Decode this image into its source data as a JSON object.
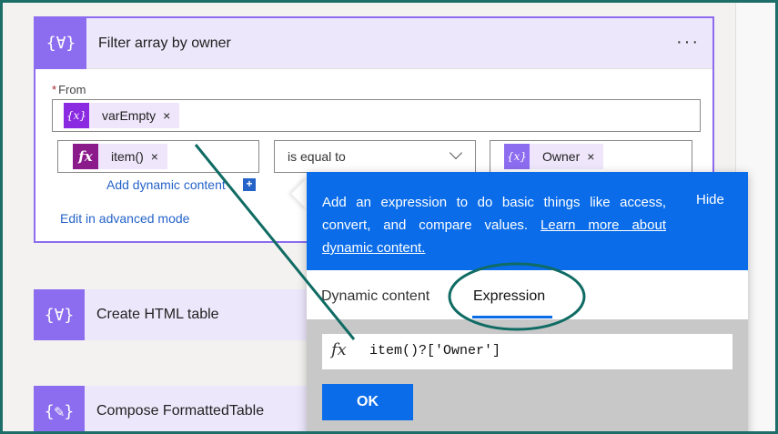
{
  "cards": {
    "filter": {
      "title": "Filter array by owner",
      "icon": "{∀}",
      "more": "···",
      "from_label": "From",
      "required_mark": "*",
      "from_token": {
        "label": "varEmpty",
        "icon": "{x}",
        "remove": "×"
      },
      "left_token": {
        "label": "item()",
        "icon": "fx",
        "remove": "×"
      },
      "operator": "is equal to",
      "right_token": {
        "label": "Owner",
        "icon": "{x}",
        "remove": "×"
      },
      "add_dynamic": "Add dynamic content",
      "add_plus": "+",
      "edit_advanced": "Edit in advanced mode"
    },
    "html_table": {
      "title": "Create HTML table",
      "icon": "{∀}"
    },
    "compose": {
      "title": "Compose FormattedTable",
      "icon": "{✎}"
    }
  },
  "popup": {
    "info_text": "Add an expression to do basic things like access, convert, and compare values.",
    "info_link": "Learn more about dynamic content.",
    "hide": "Hide",
    "tabs": [
      "Dynamic content",
      "Expression"
    ],
    "active_tab": "Expression",
    "fx": "fx",
    "expression": "item()?['Owner']",
    "ok": "OK"
  },
  "colors": {
    "accent": "#8c6cef",
    "token_fx": "#8b1a8b",
    "info_blue": "#0a6ce9",
    "annotation": "#0f6b63",
    "frame_border": "#1d6e68"
  },
  "icons": {
    "card": "filter-icon",
    "compose": "compose-icon",
    "variable": "variable-icon",
    "expression": "fx-icon",
    "remove": "close-icon",
    "chevron": "chevron-down-icon"
  }
}
